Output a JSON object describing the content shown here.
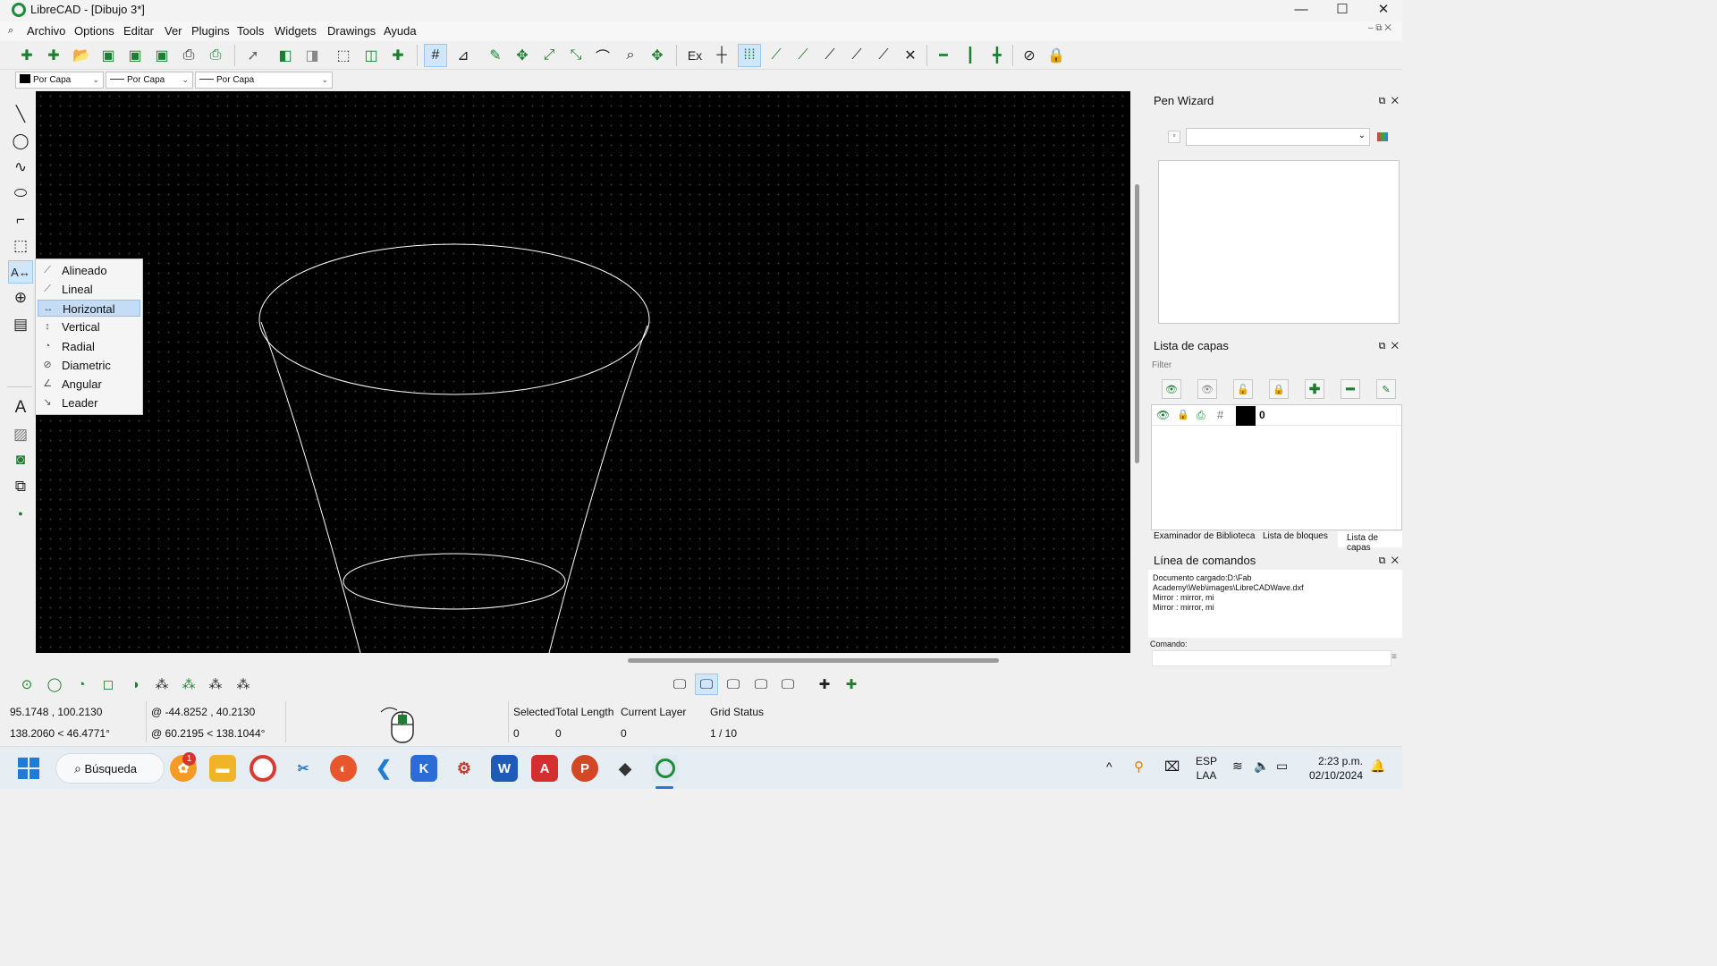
{
  "window": {
    "title": "LibreCAD - [Dibujo 3*]"
  },
  "menu": [
    "Archivo",
    "Options",
    "Editar",
    "Ver",
    "Plugins",
    "Tools",
    "Widgets",
    "Drawings",
    "Ayuda"
  ],
  "toolbar": {
    "ex_label": "Ex"
  },
  "pen": {
    "color": "Por Capa",
    "width": "Por Capa",
    "linetype": "Por Capa"
  },
  "dimension_menu": {
    "items": [
      "Alineado",
      "Lineal",
      "Horizontal",
      "Vertical",
      "Radial",
      "Diametric",
      "Angular",
      "Leader"
    ],
    "highlighted": "Horizontal"
  },
  "pen_wizard": {
    "title": "Pen Wizard"
  },
  "layers": {
    "title": "Lista de capas",
    "filter_label": "Filter",
    "rows": [
      {
        "name": "0",
        "color": "#000000"
      }
    ],
    "tabs": [
      "Examinador de Biblioteca",
      "Lista de bloques",
      "Lista de capas"
    ]
  },
  "command_line": {
    "title": "Línea de comandos",
    "history": [
      "Documento cargado:D:\\Fab Academy\\Web\\images\\LibreCADWave.dxf",
      "Mirror : mirror, mi",
      "Mirror : mirror, mi"
    ],
    "prompt_label": "Comando:"
  },
  "status": {
    "abs_coord": "95.1748 , 100.2130",
    "abs_polar": "138.2060 < 46.4771°",
    "rel_coord": "@  -44.8252 , 40.2130",
    "rel_polar": "@  60.2195 < 138.1044°",
    "selected_label": "Selected",
    "selected_value": "0",
    "total_length_label": "Total Length",
    "total_length_value": "0",
    "current_layer_label": "Current Layer",
    "current_layer_value": "0",
    "grid_status_label": "Grid Status",
    "grid_status_value": "1 / 10"
  },
  "taskbar": {
    "search_label": "Búsqueda",
    "badge_count": "1",
    "language": "ESP",
    "layout": "LAA",
    "time": "2:23 p.m.",
    "date": "02/10/2024"
  },
  "colors": {
    "accent_green": "#1a7f2e",
    "canvas_bg": "#000000",
    "selection_blue": "#c4dcf5"
  }
}
